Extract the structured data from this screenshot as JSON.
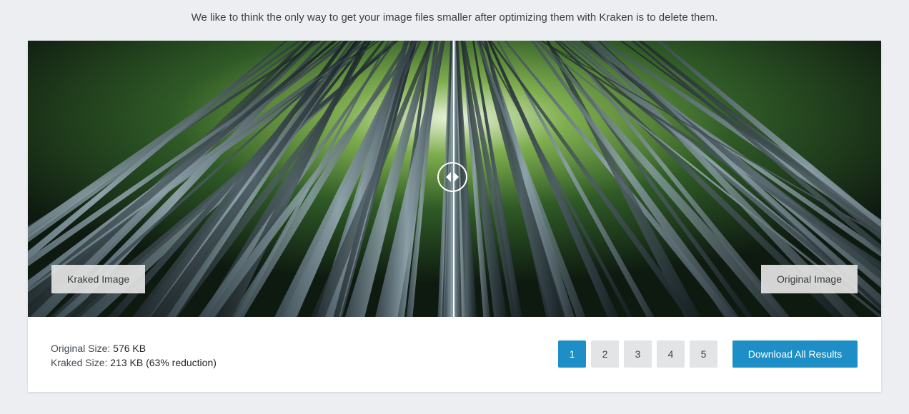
{
  "tagline": "We like to think the only way to get your image files smaller after optimizing them with Kraken is to delete them.",
  "comparison": {
    "left_label": "Kraked Image",
    "right_label": "Original Image",
    "slider_position_percent": 50
  },
  "stats": {
    "original_label": "Original Size:",
    "original_value": "576 KB",
    "kraked_label": "Kraked Size:",
    "kraked_value": "213 KB (63% reduction)"
  },
  "pagination": {
    "pages": [
      "1",
      "2",
      "3",
      "4",
      "5"
    ],
    "active_page": "1"
  },
  "download_label": "Download All Results",
  "colors": {
    "accent": "#1d8fc6",
    "background": "#eceef2",
    "card": "#ffffff"
  },
  "icons": {
    "slider_handle": "left-right-arrows-icon"
  }
}
